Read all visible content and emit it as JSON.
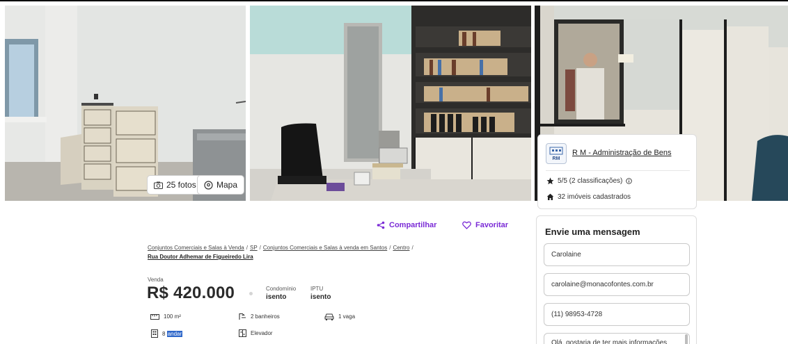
{
  "gallery": {
    "photos_label": "25 fotos",
    "map_label": "Mapa"
  },
  "advertiser": {
    "logo_text": "RM",
    "name": "R M - Administração de Bens",
    "rating": "5/5 (2 classificações)",
    "listings": "32 imóveis cadastrados"
  },
  "actions": {
    "share_label": "Compartilhar",
    "favorite_label": "Favoritar",
    "accent": "#7b2bd6"
  },
  "breadcrumb": {
    "items": [
      "Conjuntos Comerciais e Salas à Venda",
      "SP",
      "Conjuntos Comerciais e Salas à venda em Santos",
      "Centro"
    ],
    "separator": "/",
    "current": "Rua Doutor Adhemar de Figueiredo Lira"
  },
  "listing": {
    "price_label": "Venda",
    "price": "R$ 420.000",
    "condominium_label": "Condomínio",
    "condominium_value": "isento",
    "iptu_label": "IPTU",
    "iptu_value": "isento",
    "features": {
      "area": "100 m²",
      "bathrooms": "2 banheiros",
      "parking": "1 vaga",
      "floor_number": "8",
      "floor_word": "andar",
      "elevator": "Elevador"
    }
  },
  "message_form": {
    "title": "Envie uma mensagem",
    "name_value": "Carolaine",
    "email_value": "carolaine@monacofontes.com.br",
    "phone_value": "(11) 98953-4728",
    "message_value": "Olá, gostaria de ter mais informações"
  }
}
